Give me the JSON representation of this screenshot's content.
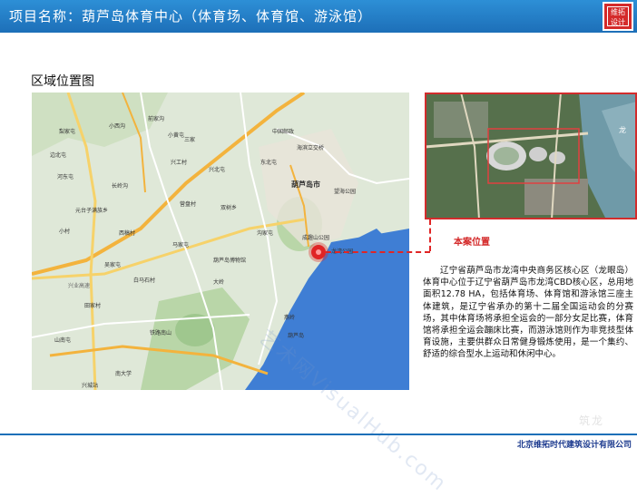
{
  "header": {
    "title": "项目名称：葫芦岛体育中心（体育场、体育馆、游泳馆）",
    "logo_text": "维拓设计"
  },
  "section": {
    "title": "区域位置图"
  },
  "map": {
    "labels": [
      "小西沟",
      "梨家屯",
      "前家沟",
      "小黄屯",
      "边北屯",
      "河东屯",
      "长岭沟",
      "元台子满族乡",
      "西稿村",
      "小村",
      "兴工村",
      "三家",
      "兴北屯",
      "营盘村",
      "马家屯",
      "吴家屯",
      "白马石村",
      "田家村",
      "山南屯",
      "兴业高速",
      "葫芦岛市",
      "海滨立交桥",
      "东北屯",
      "双树乡",
      "沟家屯",
      "葫芦岛博物馆",
      "龙湾公园",
      "望海公园",
      "成趣山公园",
      "大岭",
      "铁路南山",
      "燕岭",
      "南大学",
      "兴城站",
      "葫芦岛",
      "中国邮政"
    ]
  },
  "aerial": {
    "map_label": "龙"
  },
  "case_label": "本案位置",
  "description": "辽宁省葫芦岛市龙湾中央商务区核心区（龙眼岛）体育中心位于辽宁省葫芦岛市龙湾CBD核心区，总用地面积12.78 HA，包括体育场、体育馆和游泳馆三座主体建筑，是辽宁省承办的第十二届全国运动会的分赛场，其中体育场将承担全运会的一部分女足比赛，体育馆将承担全运会蹦床比赛，而游泳馆则作为非竞技型体育设施，主要供群众日常健身锻炼使用，是一个集约、舒适的综合型水上运动和休闲中心。",
  "watermark": "艺术网VisualHub.com",
  "footer": {
    "company": "北京维拓时代建筑设计有限公司",
    "mark": "筑龙"
  },
  "colors": {
    "header_blue": "#1d6fb8",
    "accent_red": "#d42a2a",
    "sea_blue": "#3f7ed4"
  }
}
